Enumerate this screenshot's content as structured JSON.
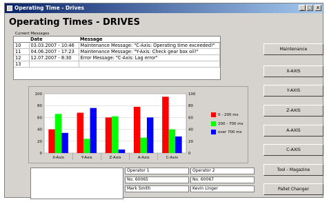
{
  "window": {
    "title": "Operating Time - Drives",
    "minimize": "_",
    "maximize": "□",
    "close": "x"
  },
  "heading": "Operating Times - DRIVES",
  "messages": {
    "caption": "Current Messages",
    "columns": [
      "",
      "Date",
      "Message"
    ],
    "rows": [
      {
        "num": "10",
        "date": "03.03.2007 - 10:46",
        "message": "Maintenance Message: \"C-Axis: Operating time exceeded!\""
      },
      {
        "num": "11",
        "date": "04.06.2007 - 17:23",
        "message": "Maintenance Message: \"Y-Axis: Check gear box oil!\""
      },
      {
        "num": "12",
        "date": "12.07.2007 - 8:30",
        "message": "Error Message: \"C-Axis: Lag error\""
      },
      {
        "num": "13",
        "date": "",
        "message": ""
      }
    ]
  },
  "chart_data": {
    "type": "bar",
    "categories": [
      "X-Axis",
      "Y-Axis",
      "Z-Axis",
      "A-Axis",
      "C-Axis"
    ],
    "series": [
      {
        "name": "0 - 200 ms",
        "color": "#ff0000",
        "values": [
          40,
          68,
          60,
          78,
          95
        ]
      },
      {
        "name": "200 - 700 ms",
        "color": "#00ff00",
        "values": [
          66,
          24,
          62,
          26,
          40
        ]
      },
      {
        "name": "over 700 ms",
        "color": "#0000ff",
        "values": [
          34,
          76,
          6,
          60,
          28
        ]
      }
    ],
    "ylim": [
      0,
      100
    ],
    "yticks": [
      0,
      20,
      40,
      60,
      80,
      100
    ],
    "grid": true,
    "legend_position": "right"
  },
  "side_buttons": [
    "Maintenance",
    "X-AXIS",
    "Y-AXIS",
    "Z-AXIS",
    "A-AXIS",
    "C-AXIS",
    "Tool - Magazine",
    "Pallet Changer"
  ],
  "operators": {
    "op1": {
      "label": "Operator 1",
      "number": "No. 60065",
      "name": "Mark Smith"
    },
    "op2": {
      "label": "Operator 2",
      "number": "No. 60067",
      "name": "Kevin Linger"
    }
  }
}
